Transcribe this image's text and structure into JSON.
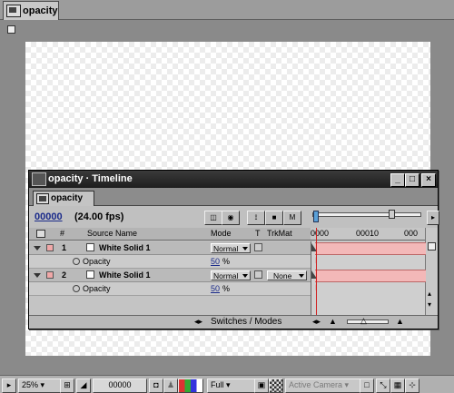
{
  "comp_window": {
    "tab_label": "opacity"
  },
  "timeline": {
    "title": "opacity · Timeline",
    "tab_label": "opacity",
    "timecode": "00000",
    "fps": "(24.00 fps)",
    "columns": {
      "num": "#",
      "source": "Source Name",
      "mode": "Mode",
      "t": "T",
      "trkmat": "TrkMat"
    },
    "ruler": {
      "start": "0000",
      "mid": "00010",
      "end": "000"
    },
    "layers": [
      {
        "num": "1",
        "name": "White Solid 1",
        "mode": "Normal",
        "trkmat": "",
        "property": "Opacity",
        "value": "50",
        "unit": "%"
      },
      {
        "num": "2",
        "name": "White Solid 1",
        "mode": "Normal",
        "trkmat": "None",
        "property": "Opacity",
        "value": "50",
        "unit": "%"
      }
    ],
    "footer_label": "Switches / Modes"
  },
  "bottom_bar": {
    "zoom": "25%",
    "timecode": "00000",
    "resolution": "Full",
    "camera": "Active Camera"
  }
}
